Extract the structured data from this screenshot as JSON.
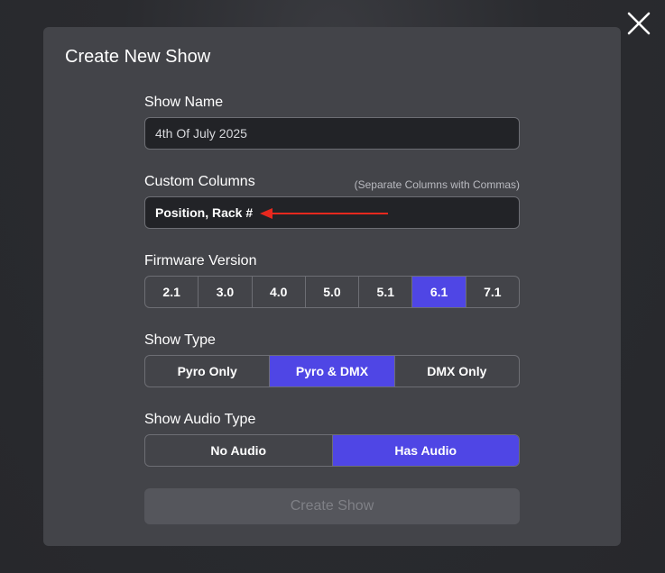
{
  "modal": {
    "title": "Create New Show",
    "create_button_label": "Create Show"
  },
  "show_name": {
    "label": "Show Name",
    "value": "4th Of July 2025"
  },
  "custom_columns": {
    "label": "Custom Columns",
    "hint": "(Separate Columns with Commas)",
    "value": "Position, Rack #"
  },
  "firmware": {
    "label": "Firmware Version",
    "options": [
      "2.1",
      "3.0",
      "4.0",
      "5.0",
      "5.1",
      "6.1",
      "7.1"
    ],
    "selected": "6.1"
  },
  "show_type": {
    "label": "Show Type",
    "options": [
      "Pyro Only",
      "Pyro & DMX",
      "DMX Only"
    ],
    "selected": "Pyro & DMX"
  },
  "audio_type": {
    "label": "Show Audio Type",
    "options": [
      "No Audio",
      "Has Audio"
    ],
    "selected": "Has Audio"
  },
  "colors": {
    "accent": "#4f46e5",
    "modal_bg": "#434449",
    "input_bg": "#222327",
    "annotation_arrow": "#e8281e"
  },
  "icons": {
    "close": "close-icon",
    "annotation": "arrow-left-icon"
  }
}
